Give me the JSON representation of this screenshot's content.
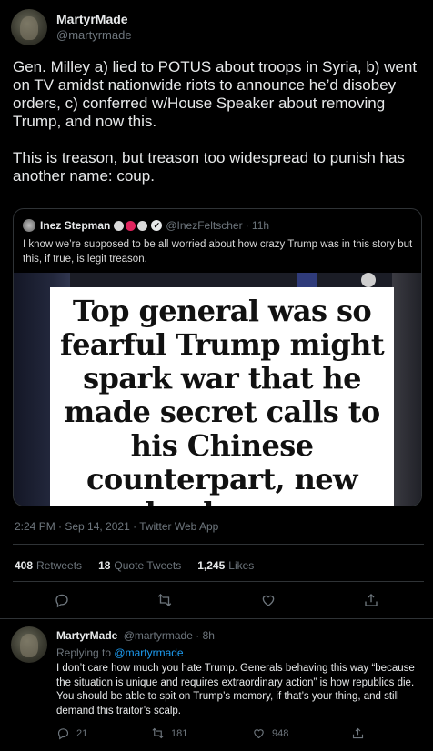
{
  "tweet": {
    "author_name": "MartyrMade",
    "author_handle": "@martyrmade",
    "text": "Gen. Milley a) lied to POTUS about troops in Syria, b) went on TV amidst nationwide riots to announce he’d disobey orders, c) conferred w/House Speaker about removing Trump, and now this.\n\nThis is treason, but treason too widespread to punish has another name: coup.",
    "quote": {
      "author_name": "Inez Stepman",
      "author_handle": "@InezFeltscher",
      "time": "· 11h",
      "emoji_colors": [
        "#d9d9d9",
        "#e0245e",
        "#d9d9d9"
      ],
      "text": "I know we’re supposed to be all worried about how crazy Trump was in this story but this, if true, is legit treason.",
      "image_headline": "Top general was so fearful Trump might spark war that he made secret calls to his Chinese counterpart, new book says"
    },
    "meta": "2:24 PM · Sep 14, 2021 · Twitter Web App",
    "stats": {
      "retweets_count": "408",
      "retweets_label": "Retweets",
      "quotes_count": "18",
      "quotes_label": "Quote Tweets",
      "likes_count": "1,245",
      "likes_label": "Likes"
    },
    "actions": [
      "reply-icon",
      "retweet-icon",
      "like-icon",
      "share-icon"
    ]
  },
  "reply": {
    "author_name": "MartyrMade",
    "author_handle": "@martyrmade",
    "time": "· 8h",
    "replying_prefix": "Replying to",
    "replying_to": "@martyrmade",
    "text": "I don’t care how much you hate Trump. Generals behaving this way “because the situation is unique and requires extraordinary action” is how republics die. You should be able to spit on Trump’s memory, if that’s your thing, and still demand this traitor’s scalp.",
    "replies": "21",
    "retweets": "181",
    "likes": "948"
  },
  "colors": {
    "background": "#000000",
    "text": "#e7e9ea",
    "muted": "#6e767d",
    "border": "#2f3336",
    "link": "#1d9bf0"
  }
}
